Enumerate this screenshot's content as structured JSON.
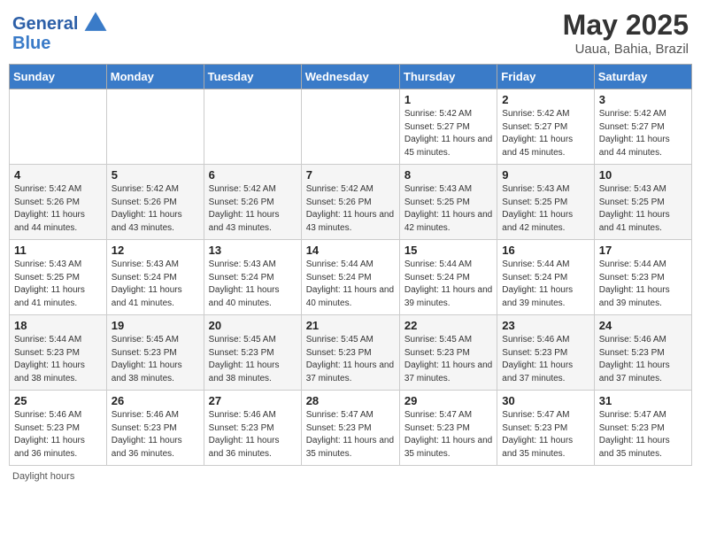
{
  "header": {
    "logo_text_general": "General",
    "logo_text_blue": "Blue",
    "month_year": "May 2025",
    "location": "Uaua, Bahia, Brazil"
  },
  "days_of_week": [
    "Sunday",
    "Monday",
    "Tuesday",
    "Wednesday",
    "Thursday",
    "Friday",
    "Saturday"
  ],
  "footer": {
    "daylight_hours": "Daylight hours"
  },
  "weeks": [
    [
      {
        "day": "",
        "sunrise": "",
        "sunset": "",
        "daylight": ""
      },
      {
        "day": "",
        "sunrise": "",
        "sunset": "",
        "daylight": ""
      },
      {
        "day": "",
        "sunrise": "",
        "sunset": "",
        "daylight": ""
      },
      {
        "day": "",
        "sunrise": "",
        "sunset": "",
        "daylight": ""
      },
      {
        "day": "1",
        "sunrise": "Sunrise: 5:42 AM",
        "sunset": "Sunset: 5:27 PM",
        "daylight": "Daylight: 11 hours and 45 minutes."
      },
      {
        "day": "2",
        "sunrise": "Sunrise: 5:42 AM",
        "sunset": "Sunset: 5:27 PM",
        "daylight": "Daylight: 11 hours and 45 minutes."
      },
      {
        "day": "3",
        "sunrise": "Sunrise: 5:42 AM",
        "sunset": "Sunset: 5:27 PM",
        "daylight": "Daylight: 11 hours and 44 minutes."
      }
    ],
    [
      {
        "day": "4",
        "sunrise": "Sunrise: 5:42 AM",
        "sunset": "Sunset: 5:26 PM",
        "daylight": "Daylight: 11 hours and 44 minutes."
      },
      {
        "day": "5",
        "sunrise": "Sunrise: 5:42 AM",
        "sunset": "Sunset: 5:26 PM",
        "daylight": "Daylight: 11 hours and 43 minutes."
      },
      {
        "day": "6",
        "sunrise": "Sunrise: 5:42 AM",
        "sunset": "Sunset: 5:26 PM",
        "daylight": "Daylight: 11 hours and 43 minutes."
      },
      {
        "day": "7",
        "sunrise": "Sunrise: 5:42 AM",
        "sunset": "Sunset: 5:26 PM",
        "daylight": "Daylight: 11 hours and 43 minutes."
      },
      {
        "day": "8",
        "sunrise": "Sunrise: 5:43 AM",
        "sunset": "Sunset: 5:25 PM",
        "daylight": "Daylight: 11 hours and 42 minutes."
      },
      {
        "day": "9",
        "sunrise": "Sunrise: 5:43 AM",
        "sunset": "Sunset: 5:25 PM",
        "daylight": "Daylight: 11 hours and 42 minutes."
      },
      {
        "day": "10",
        "sunrise": "Sunrise: 5:43 AM",
        "sunset": "Sunset: 5:25 PM",
        "daylight": "Daylight: 11 hours and 41 minutes."
      }
    ],
    [
      {
        "day": "11",
        "sunrise": "Sunrise: 5:43 AM",
        "sunset": "Sunset: 5:25 PM",
        "daylight": "Daylight: 11 hours and 41 minutes."
      },
      {
        "day": "12",
        "sunrise": "Sunrise: 5:43 AM",
        "sunset": "Sunset: 5:24 PM",
        "daylight": "Daylight: 11 hours and 41 minutes."
      },
      {
        "day": "13",
        "sunrise": "Sunrise: 5:43 AM",
        "sunset": "Sunset: 5:24 PM",
        "daylight": "Daylight: 11 hours and 40 minutes."
      },
      {
        "day": "14",
        "sunrise": "Sunrise: 5:44 AM",
        "sunset": "Sunset: 5:24 PM",
        "daylight": "Daylight: 11 hours and 40 minutes."
      },
      {
        "day": "15",
        "sunrise": "Sunrise: 5:44 AM",
        "sunset": "Sunset: 5:24 PM",
        "daylight": "Daylight: 11 hours and 39 minutes."
      },
      {
        "day": "16",
        "sunrise": "Sunrise: 5:44 AM",
        "sunset": "Sunset: 5:24 PM",
        "daylight": "Daylight: 11 hours and 39 minutes."
      },
      {
        "day": "17",
        "sunrise": "Sunrise: 5:44 AM",
        "sunset": "Sunset: 5:23 PM",
        "daylight": "Daylight: 11 hours and 39 minutes."
      }
    ],
    [
      {
        "day": "18",
        "sunrise": "Sunrise: 5:44 AM",
        "sunset": "Sunset: 5:23 PM",
        "daylight": "Daylight: 11 hours and 38 minutes."
      },
      {
        "day": "19",
        "sunrise": "Sunrise: 5:45 AM",
        "sunset": "Sunset: 5:23 PM",
        "daylight": "Daylight: 11 hours and 38 minutes."
      },
      {
        "day": "20",
        "sunrise": "Sunrise: 5:45 AM",
        "sunset": "Sunset: 5:23 PM",
        "daylight": "Daylight: 11 hours and 38 minutes."
      },
      {
        "day": "21",
        "sunrise": "Sunrise: 5:45 AM",
        "sunset": "Sunset: 5:23 PM",
        "daylight": "Daylight: 11 hours and 37 minutes."
      },
      {
        "day": "22",
        "sunrise": "Sunrise: 5:45 AM",
        "sunset": "Sunset: 5:23 PM",
        "daylight": "Daylight: 11 hours and 37 minutes."
      },
      {
        "day": "23",
        "sunrise": "Sunrise: 5:46 AM",
        "sunset": "Sunset: 5:23 PM",
        "daylight": "Daylight: 11 hours and 37 minutes."
      },
      {
        "day": "24",
        "sunrise": "Sunrise: 5:46 AM",
        "sunset": "Sunset: 5:23 PM",
        "daylight": "Daylight: 11 hours and 37 minutes."
      }
    ],
    [
      {
        "day": "25",
        "sunrise": "Sunrise: 5:46 AM",
        "sunset": "Sunset: 5:23 PM",
        "daylight": "Daylight: 11 hours and 36 minutes."
      },
      {
        "day": "26",
        "sunrise": "Sunrise: 5:46 AM",
        "sunset": "Sunset: 5:23 PM",
        "daylight": "Daylight: 11 hours and 36 minutes."
      },
      {
        "day": "27",
        "sunrise": "Sunrise: 5:46 AM",
        "sunset": "Sunset: 5:23 PM",
        "daylight": "Daylight: 11 hours and 36 minutes."
      },
      {
        "day": "28",
        "sunrise": "Sunrise: 5:47 AM",
        "sunset": "Sunset: 5:23 PM",
        "daylight": "Daylight: 11 hours and 35 minutes."
      },
      {
        "day": "29",
        "sunrise": "Sunrise: 5:47 AM",
        "sunset": "Sunset: 5:23 PM",
        "daylight": "Daylight: 11 hours and 35 minutes."
      },
      {
        "day": "30",
        "sunrise": "Sunrise: 5:47 AM",
        "sunset": "Sunset: 5:23 PM",
        "daylight": "Daylight: 11 hours and 35 minutes."
      },
      {
        "day": "31",
        "sunrise": "Sunrise: 5:47 AM",
        "sunset": "Sunset: 5:23 PM",
        "daylight": "Daylight: 11 hours and 35 minutes."
      }
    ]
  ]
}
